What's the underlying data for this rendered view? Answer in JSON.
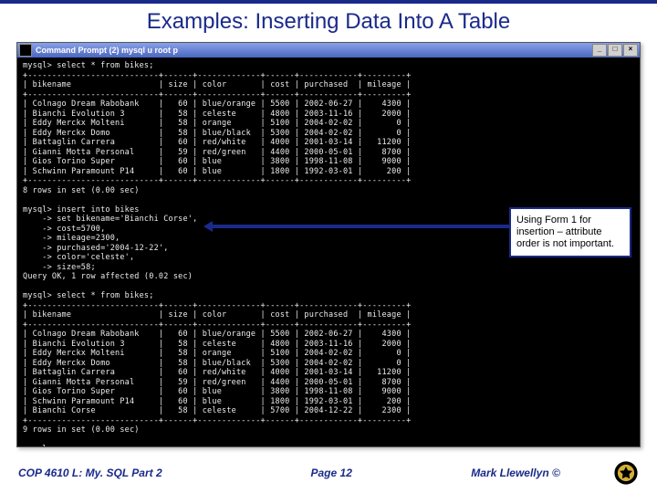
{
  "title": "Examples: Inserting Data Into A Table",
  "window_title": "Command Prompt (2)   mysql  u root  p",
  "window_controls": {
    "min": "_",
    "max": "□",
    "close": "×"
  },
  "terminal_lines": [
    "mysql> select * from bikes;",
    "+---------------------------+------+-------------+------+------------+---------+",
    "| bikename                  | size | color       | cost | purchased  | mileage |",
    "+---------------------------+------+-------------+------+------------+---------+",
    "| Colnago Dream Rabobank    |   60 | blue/orange | 5500 | 2002-06-27 |    4300 |",
    "| Bianchi Evolution 3       |   58 | celeste     | 4800 | 2003-11-16 |    2000 |",
    "| Eddy Merckx Molteni       |   58 | orange      | 5100 | 2004-02-02 |       0 |",
    "| Eddy Merckx Domo          |   58 | blue/black  | 5300 | 2004-02-02 |       0 |",
    "| Battaglin Carrera         |   60 | red/white   | 4000 | 2001-03-14 |   11200 |",
    "| Gianni Motta Personal     |   59 | red/green   | 4400 | 2000-05-01 |    8700 |",
    "| Gios Torino Super         |   60 | blue        | 3800 | 1998-11-08 |    9000 |",
    "| Schwinn Paramount P14     |   60 | blue        | 1800 | 1992-03-01 |     200 |",
    "+---------------------------+------+-------------+------+------------+---------+",
    "8 rows in set (0.00 sec)",
    "",
    "mysql> insert into bikes",
    "    -> set bikename='Bianchi Corse',",
    "    -> cost=5700,",
    "    -> mileage=2300,",
    "    -> purchased='2004-12-22',",
    "    -> color='celeste',",
    "    -> size=58;",
    "Query OK, 1 row affected (0.02 sec)",
    "",
    "mysql> select * from bikes;",
    "+---------------------------+------+-------------+------+------------+---------+",
    "| bikename                  | size | color       | cost | purchased  | mileage |",
    "+---------------------------+------+-------------+------+------------+---------+",
    "| Colnago Dream Rabobank    |   60 | blue/orange | 5500 | 2002-06-27 |    4300 |",
    "| Bianchi Evolution 3       |   58 | celeste     | 4800 | 2003-11-16 |    2000 |",
    "| Eddy Merckx Molteni       |   58 | orange      | 5100 | 2004-02-02 |       0 |",
    "| Eddy Merckx Domo          |   58 | blue/black  | 5300 | 2004-02-02 |       0 |",
    "| Battaglin Carrera         |   60 | red/white   | 4000 | 2001-03-14 |   11200 |",
    "| Gianni Motta Personal     |   59 | red/green   | 4400 | 2000-05-01 |    8700 |",
    "| Gios Torino Super         |   60 | blue        | 3800 | 1998-11-08 |    9000 |",
    "| Schwinn Paramount P14     |   60 | blue        | 1800 | 1992-03-01 |     200 |",
    "| Bianchi Corse             |   58 | celeste     | 5700 | 2004-12-22 |    2300 |",
    "+---------------------------+------+-------------+------+------------+---------+",
    "9 rows in set (0.00 sec)",
    "",
    "mysql>_"
  ],
  "annotation": "Using Form 1 for insertion – attribute order is not important.",
  "footer": {
    "left": "COP 4610 L: My. SQL Part 2",
    "center": "Page 12",
    "right": "Mark Llewellyn ©"
  }
}
